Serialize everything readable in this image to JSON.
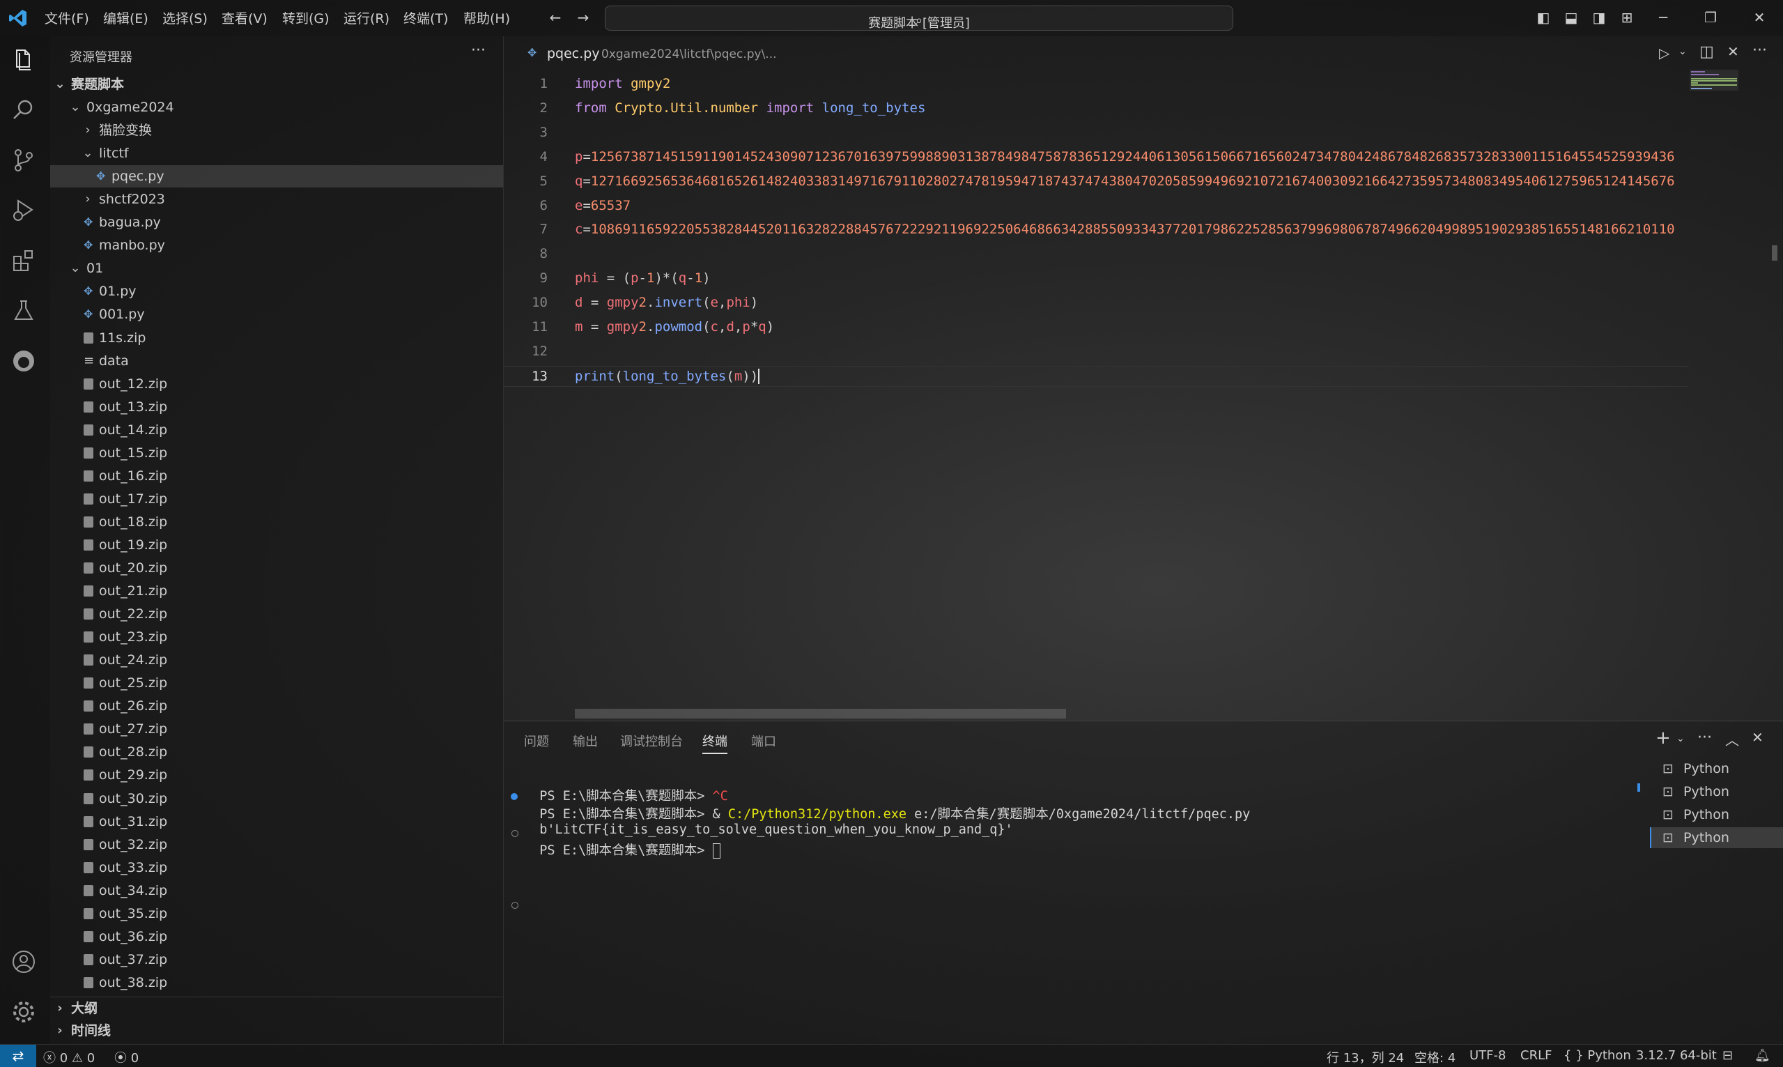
{
  "menu": [
    "文件(F)",
    "编辑(E)",
    "选择(S)",
    "查看(V)",
    "转到(G)",
    "运行(R)",
    "终端(T)",
    "帮助(H)"
  ],
  "command_center": "赛题脚本 [管理员]",
  "sidebar": {
    "title": "资源管理器",
    "root": "赛题脚本",
    "tree": [
      {
        "label": "0xgame2024",
        "type": "folder-open"
      },
      {
        "label": "猫脸变换",
        "type": "folder-closed"
      },
      {
        "label": "litctf",
        "type": "folder-open"
      },
      {
        "label": "pqec.py",
        "type": "py",
        "selected": true
      },
      {
        "label": "shctf2023",
        "type": "folder-closed"
      },
      {
        "label": "bagua.py",
        "type": "py"
      },
      {
        "label": "manbo.py",
        "type": "py"
      },
      {
        "label": "01",
        "type": "folder-open"
      },
      {
        "label": "01.py",
        "type": "py"
      },
      {
        "label": "001.py",
        "type": "py"
      },
      {
        "label": "11s.zip",
        "type": "zip"
      },
      {
        "label": "data",
        "type": "txt"
      },
      {
        "label": "out_12.zip",
        "type": "zip"
      },
      {
        "label": "out_13.zip",
        "type": "zip"
      },
      {
        "label": "out_14.zip",
        "type": "zip"
      },
      {
        "label": "out_15.zip",
        "type": "zip"
      },
      {
        "label": "out_16.zip",
        "type": "zip"
      },
      {
        "label": "out_17.zip",
        "type": "zip"
      },
      {
        "label": "out_18.zip",
        "type": "zip"
      },
      {
        "label": "out_19.zip",
        "type": "zip"
      },
      {
        "label": "out_20.zip",
        "type": "zip"
      },
      {
        "label": "out_21.zip",
        "type": "zip"
      },
      {
        "label": "out_22.zip",
        "type": "zip"
      },
      {
        "label": "out_23.zip",
        "type": "zip"
      },
      {
        "label": "out_24.zip",
        "type": "zip"
      },
      {
        "label": "out_25.zip",
        "type": "zip"
      },
      {
        "label": "out_26.zip",
        "type": "zip"
      },
      {
        "label": "out_27.zip",
        "type": "zip"
      },
      {
        "label": "out_28.zip",
        "type": "zip"
      },
      {
        "label": "out_29.zip",
        "type": "zip"
      },
      {
        "label": "out_30.zip",
        "type": "zip"
      },
      {
        "label": "out_31.zip",
        "type": "zip"
      },
      {
        "label": "out_32.zip",
        "type": "zip"
      },
      {
        "label": "out_33.zip",
        "type": "zip"
      },
      {
        "label": "out_34.zip",
        "type": "zip"
      },
      {
        "label": "out_35.zip",
        "type": "zip"
      },
      {
        "label": "out_36.zip",
        "type": "zip"
      },
      {
        "label": "out_37.zip",
        "type": "zip"
      },
      {
        "label": "out_38.zip",
        "type": "zip"
      }
    ],
    "outline": "大纲",
    "timeline": "时间线"
  },
  "editor": {
    "tab_name": "pqec.py",
    "tab_path": "0xgame2024\\litctf\\pqec.py\\...",
    "current_line": 13,
    "lines": [
      "import gmpy2",
      "from Crypto.Util.number import long_to_bytes",
      "",
      "p=1256738714515911901452430907123670163975998890313878498475878365129244061305615066716560247347804248678482683573283300115164554525939436",
      "q=1271669256536468165261482403383149716791102802747819594718743747438047020585994969210721674003092166427359573480834954061275965124145676",
      "e=65537",
      "c=1086911659220553828445201163282288457672229211969225064686634288550933437720179862252856379969806787496620499895190293851655148166210110",
      "",
      "phi = (p-1)*(q-1)",
      "d = gmpy2.invert(e,phi)",
      "m = gmpy2.powmod(c,d,p*q)",
      "",
      "print(long_to_bytes(m))"
    ]
  },
  "panel": {
    "tabs": [
      "问题",
      "输出",
      "调试控制台",
      "终端",
      "端口"
    ],
    "active_tab": "终端",
    "terminal": {
      "line1_prompt": "PS E:\\脚本合集\\赛题脚本>",
      "line1_cmd": "^C",
      "line2_prompt": "PS E:\\脚本合集\\赛题脚本>",
      "line2_amp": "&",
      "line2_exe": "C:/Python312/python.exe",
      "line2_arg": "e:/脚本合集/赛题脚本/0xgame2024/litctf/pqec.py",
      "line3_output": "b'LitCTF{it_is_easy_to_solve_question_when_you_know_p_and_q}'",
      "line4_prompt": "PS E:\\脚本合集\\赛题脚本>"
    },
    "terminal_tabs": [
      "Python",
      "Python",
      "Python",
      "Python"
    ]
  },
  "statusbar": {
    "errors": "0",
    "warnings": "0",
    "ports": "0",
    "position": "行 13，列 24",
    "spaces": "空格: 4",
    "encoding": "UTF-8",
    "eol": "CRLF",
    "language": "{ } Python",
    "interpreter": "3.12.7 64-bit"
  },
  "colors": {
    "accent": "#0e639c",
    "keyword": "#c792ea",
    "module": "#ffcb6b",
    "function": "#82aaff",
    "number": "#f78c6c"
  }
}
